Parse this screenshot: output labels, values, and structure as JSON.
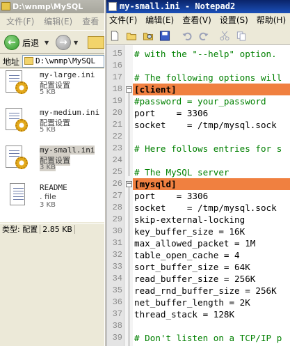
{
  "explorer": {
    "title": "D:\\wnmp\\MySQL",
    "menu": [
      "文件(F)",
      "编辑(E)",
      "查看"
    ],
    "back_label": "后退",
    "address_label": "地址",
    "address_value": "D:\\wnmp\\MySQL",
    "files": [
      {
        "name": "my-large.ini",
        "type": "配置设置",
        "size": "5 KB",
        "icon": "ini-config-icon",
        "selected": false
      },
      {
        "name": "my-medium.ini",
        "type": "配置设置",
        "size": "5 KB",
        "icon": "ini-config-icon",
        "selected": false
      },
      {
        "name": "my-small.ini",
        "type": "配置设置",
        "size": "3 KB",
        "icon": "ini-config-icon",
        "selected": true
      },
      {
        "name": "README",
        "type": ". file",
        "size": "3 KB",
        "icon": "text-file-icon",
        "selected": false
      }
    ],
    "status": {
      "type": "类型: 配置",
      "size": "2.85 KB"
    }
  },
  "notepad": {
    "title": "my-small.ini - Notepad2",
    "menu": [
      "文件(F)",
      "编辑(E)",
      "查看(V)",
      "设置(S)",
      "帮助(H)"
    ],
    "toolbar_icons": [
      "new-file-icon",
      "open-folder-icon",
      "browse-icon",
      "save-icon",
      "undo-icon",
      "redo-icon",
      "cut-icon",
      "copy-icon"
    ],
    "lines": [
      {
        "n": "15",
        "text": "# with the \"--help\" option.",
        "kind": "comment"
      },
      {
        "n": "16",
        "text": "",
        "kind": "text"
      },
      {
        "n": "17",
        "text": "# The following options will",
        "kind": "comment"
      },
      {
        "n": "18",
        "text": "[client]",
        "kind": "section"
      },
      {
        "n": "19",
        "text": "#password = your_password",
        "kind": "comment"
      },
      {
        "n": "20",
        "text": "port    = 3306",
        "kind": "text"
      },
      {
        "n": "21",
        "text": "socket    = /tmp/mysql.sock",
        "kind": "text"
      },
      {
        "n": "22",
        "text": "",
        "kind": "text"
      },
      {
        "n": "23",
        "text": "# Here follows entries for s",
        "kind": "comment"
      },
      {
        "n": "24",
        "text": "",
        "kind": "text"
      },
      {
        "n": "25",
        "text": "# The MySQL server",
        "kind": "comment"
      },
      {
        "n": "26",
        "text": "[mysqld]",
        "kind": "section"
      },
      {
        "n": "27",
        "text": "port    = 3306",
        "kind": "text"
      },
      {
        "n": "28",
        "text": "socket    = /tmp/mysql.sock",
        "kind": "text"
      },
      {
        "n": "29",
        "text": "skip-external-locking",
        "kind": "text"
      },
      {
        "n": "30",
        "text": "key_buffer_size = 16K",
        "kind": "text"
      },
      {
        "n": "31",
        "text": "max_allowed_packet = 1M",
        "kind": "text"
      },
      {
        "n": "32",
        "text": "table_open_cache = 4",
        "kind": "text"
      },
      {
        "n": "33",
        "text": "sort_buffer_size = 64K",
        "kind": "text"
      },
      {
        "n": "34",
        "text": "read_buffer_size = 256K",
        "kind": "text"
      },
      {
        "n": "35",
        "text": "read_rnd_buffer_size = 256K",
        "kind": "text"
      },
      {
        "n": "36",
        "text": "net_buffer_length = 2K",
        "kind": "text"
      },
      {
        "n": "37",
        "text": "thread_stack = 128K",
        "kind": "text"
      },
      {
        "n": "38",
        "text": "",
        "kind": "text"
      },
      {
        "n": "39",
        "text": "# Don't listen on a TCP/IP p",
        "kind": "comment"
      }
    ],
    "colors": {
      "section_highlight": "#f08040",
      "comment": "#008000"
    }
  }
}
